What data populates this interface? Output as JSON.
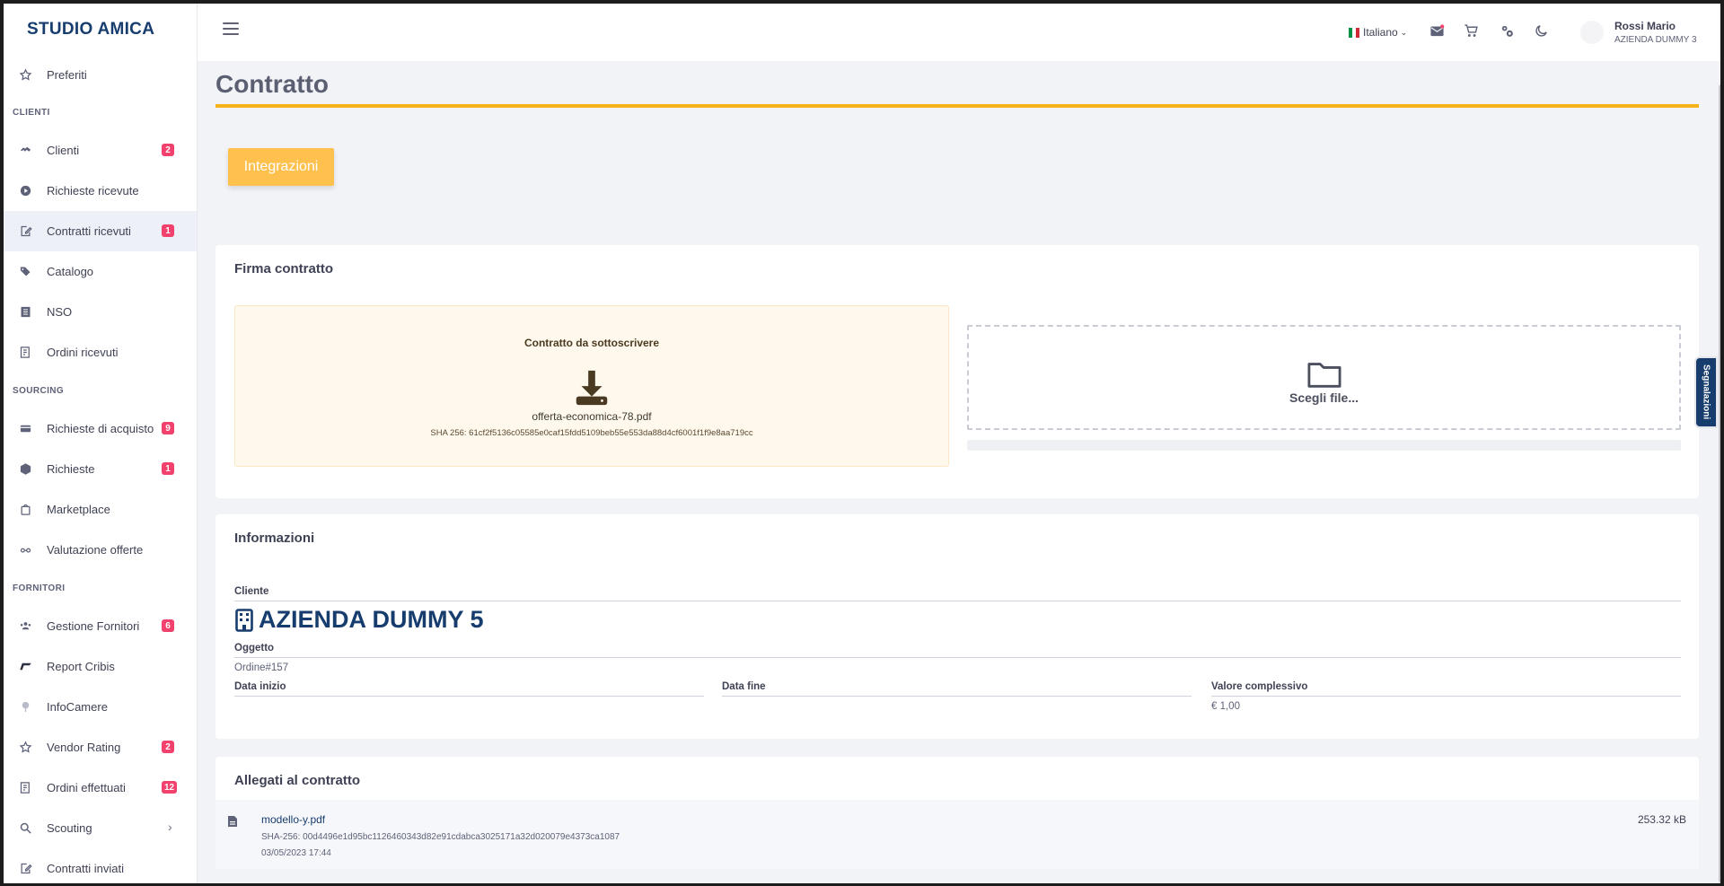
{
  "brand": "STUDIO AMICA",
  "sidebar": {
    "favorites": "Preferiti",
    "sections": {
      "clienti": "CLIENTI",
      "sourcing": "SOURCING",
      "fornitori": "FORNITORI"
    },
    "items": [
      {
        "label": "Clienti",
        "badge": "2"
      },
      {
        "label": "Richieste ricevute",
        "badge": ""
      },
      {
        "label": "Contratti ricevuti",
        "badge": "1"
      },
      {
        "label": "Catalogo",
        "badge": ""
      },
      {
        "label": "NSO",
        "badge": ""
      },
      {
        "label": "Ordini ricevuti",
        "badge": ""
      },
      {
        "label": "Richieste di acquisto",
        "badge": "9"
      },
      {
        "label": "Richieste",
        "badge": "1"
      },
      {
        "label": "Marketplace",
        "badge": ""
      },
      {
        "label": "Valutazione offerte",
        "badge": ""
      },
      {
        "label": "Gestione Fornitori",
        "badge": "6"
      },
      {
        "label": "Report Cribis",
        "badge": ""
      },
      {
        "label": "InfoCamere",
        "badge": ""
      },
      {
        "label": "Vendor Rating",
        "badge": "2"
      },
      {
        "label": "Ordini effettuati",
        "badge": "12"
      },
      {
        "label": "Scouting",
        "badge": ""
      },
      {
        "label": "Contratti inviati",
        "badge": ""
      }
    ],
    "active": "Contratti ricevuti"
  },
  "topbar": {
    "language": "Italiano",
    "user_name": "Rossi Mario",
    "user_org": "AZIENDA DUMMY 3"
  },
  "page": {
    "title": "Contratto",
    "integrations_button": "Integrazioni"
  },
  "sign": {
    "title": "Firma contratto",
    "to_sign_label": "Contratto da sottoscrivere",
    "file_name": "offerta-economica-78.pdf",
    "sha": "SHA 256: 61cf2f5136c05585e0caf15fdd5109beb55e553da88d4cf6001f1f9e8aa719cc",
    "choose_file": "Scegli file..."
  },
  "info": {
    "title": "Informazioni",
    "cliente_label": "Cliente",
    "cliente_value": "AZIENDA DUMMY 5",
    "oggetto_label": "Oggetto",
    "oggetto_value": "Ordine#157",
    "data_inizio_label": "Data inizio",
    "data_fine_label": "Data fine",
    "valore_label": "Valore complessivo",
    "valore_value": "€ 1,00"
  },
  "attachments": {
    "title": "Allegati al contratto",
    "items": [
      {
        "name": "modello-y.pdf",
        "sha": "SHA-256: 00d4496e1d95bc1126460343d82e91cdabca3025171a32d020079e4373ca1087",
        "date": "03/05/2023 17:44",
        "size": "253.32 kB"
      }
    ]
  },
  "side_tab": "Segnalazioni",
  "colors": {
    "brand": "#173d6e",
    "accent": "#f6b21b",
    "button": "#ffc14e",
    "badge": "#f1416c"
  }
}
